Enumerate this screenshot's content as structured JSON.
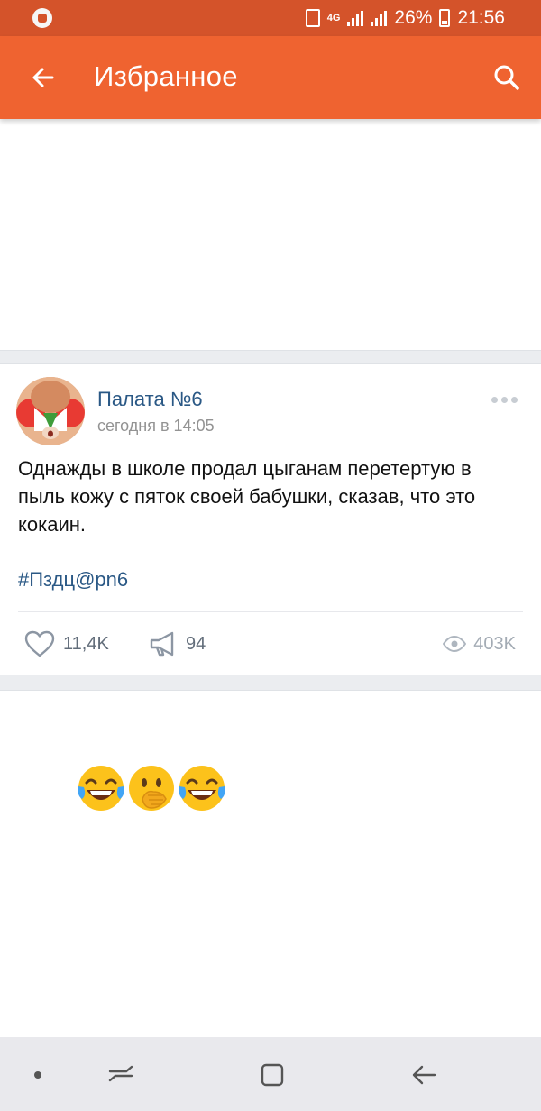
{
  "status_bar": {
    "network": "4G",
    "battery": "26%",
    "time": "21:56"
  },
  "app_bar": {
    "title": "Избранное"
  },
  "post": {
    "author": "Палата №6",
    "time": "сегодня в 14:05",
    "text": "Однажды в школе продал цыганам перетертую в пыль кожу с пяток своей бабушки, сказав, что это кокаин.",
    "hashtag": "#Пздц@pn6",
    "likes": "11,4K",
    "shares": "94",
    "views": "403K"
  },
  "icons": {
    "back": "arrow-left-icon",
    "search": "search-icon",
    "more": "more-icon",
    "like": "heart-icon",
    "share": "megaphone-icon",
    "views": "eye-icon"
  },
  "colors": {
    "accent": "#ef6330",
    "status_bar": "#d4532a",
    "link": "#2a5885"
  }
}
